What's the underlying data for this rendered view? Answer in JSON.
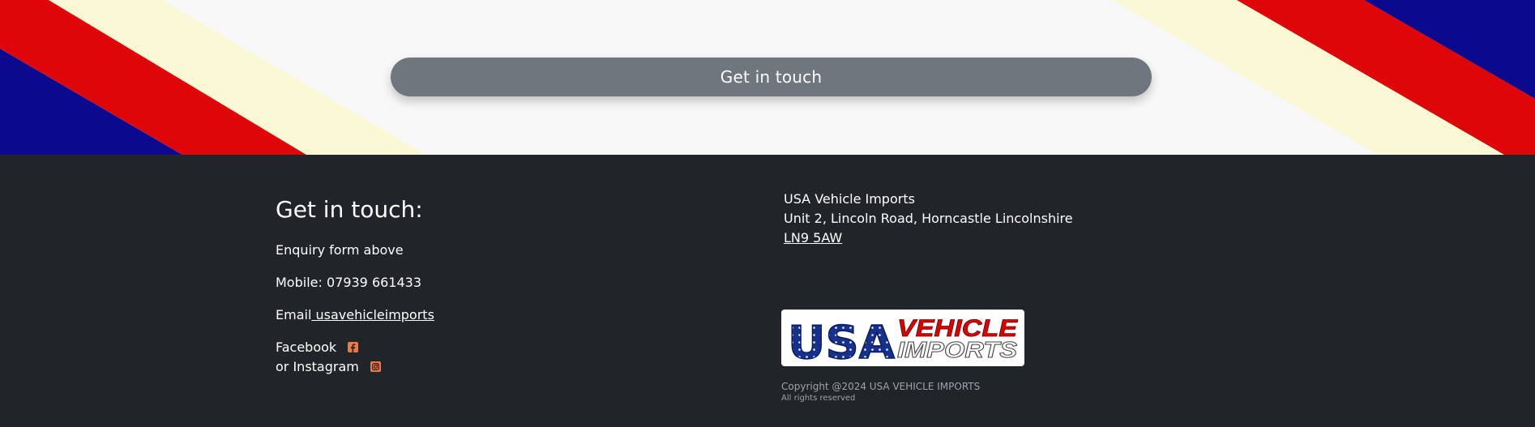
{
  "colors": {
    "hero_bg": "#f8f8f8",
    "stripe_blue": "#0b0a8f",
    "stripe_red": "#de0609",
    "stripe_cream": "#fbf8d6",
    "button_bg": "#6f767e",
    "footer_bg": "#212529",
    "icon_accent": "#f07844",
    "logo_blue": "#16308e",
    "logo_red": "#e00000"
  },
  "hero": {
    "cta_label": "Get in touch"
  },
  "footer": {
    "heading": "Get in touch:",
    "enquiry": "Enquiry form above",
    "mobile": "Mobile: 07939 661433",
    "email_label": "Email",
    "email_link": " usavehicleimports",
    "facebook_label": "Facebook",
    "instagram_label": "or Instagram",
    "facebook_icon": "facebook-square-icon",
    "instagram_icon": "instagram-square-icon",
    "company_name": "USA Vehicle Imports",
    "address_line": "Unit 2, Lincoln Road, Horncastle Lincolnshire",
    "postcode": "LN9 5AW",
    "logo": {
      "usa": "USA",
      "vehicle": "VEHICLE",
      "imports": "IMPORTS"
    },
    "copyright": "Copyright @2024 USA VEHICLE IMPORTS",
    "rights": "All rights reserved"
  }
}
